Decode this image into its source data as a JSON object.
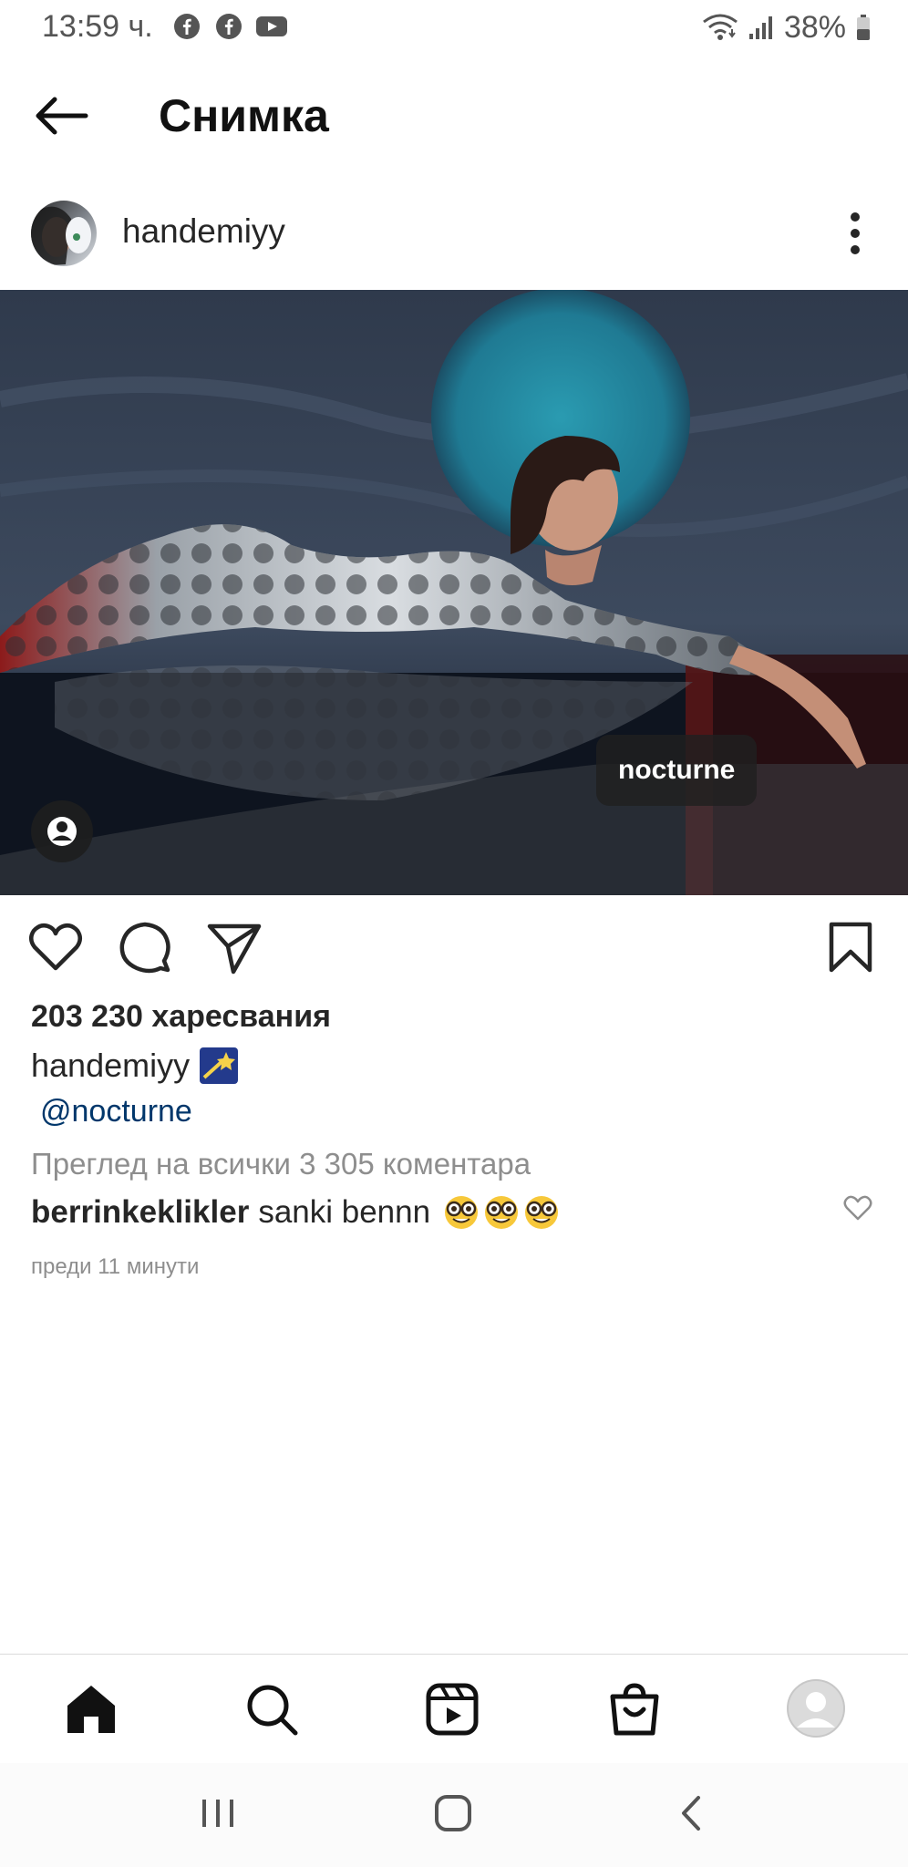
{
  "status_bar": {
    "time": "13:59 ч.",
    "battery": "38%",
    "icons": [
      "facebook-icon",
      "facebook-icon",
      "youtube-icon",
      "wifi-icon",
      "signal-icon",
      "battery-icon"
    ]
  },
  "header": {
    "title": "Снимка",
    "back_icon": "arrow-left-icon"
  },
  "post": {
    "username": "handemiyy",
    "more_icon": "more-vertical-icon",
    "photo_tag": "nocturne",
    "user_tags_icon": "person-icon",
    "likes": "203 230 харесвания",
    "caption_user": "handemiyy",
    "caption_emoji": "shooting-star-emoji",
    "mention": "@nocturne",
    "view_comments": "Преглед на всички 3 305 коментара",
    "comment": {
      "user": "berrinkeklikler",
      "text": "sanki bennn",
      "emojis": [
        "nerd-face-emoji",
        "nerd-face-emoji",
        "nerd-face-emoji"
      ]
    },
    "timestamp": "преди 11 минути"
  },
  "actions": [
    "heart-icon",
    "comment-icon",
    "share-icon",
    "bookmark-icon"
  ],
  "bottom_nav": [
    "home-icon",
    "search-icon",
    "reels-icon",
    "shop-icon",
    "profile-icon"
  ],
  "system_nav": [
    "recents-icon",
    "home-circle-icon",
    "back-chevron-icon"
  ],
  "colors": {
    "text": "#262626",
    "secondary": "#8e8e8e",
    "link": "#00376b",
    "divider": "#dbdbdb"
  }
}
